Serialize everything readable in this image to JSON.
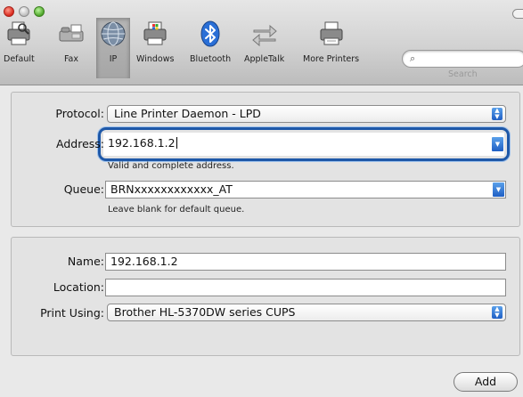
{
  "toolbar": {
    "items": [
      {
        "label": "Default",
        "icon": "default-printer-icon"
      },
      {
        "label": "Fax",
        "icon": "fax-icon"
      },
      {
        "label": "IP",
        "icon": "ip-globe-icon",
        "selected": true
      },
      {
        "label": "Windows",
        "icon": "windows-printer-icon"
      },
      {
        "label": "Bluetooth",
        "icon": "bluetooth-icon"
      },
      {
        "label": "AppleTalk",
        "icon": "appletalk-arrows-icon"
      },
      {
        "label": "More Printers",
        "icon": "more-printers-icon"
      }
    ],
    "search_label": "Search",
    "search_placeholder": ""
  },
  "connection": {
    "protocol_label": "Protocol:",
    "protocol_value": "Line Printer Daemon - LPD",
    "address_label": "Address:",
    "address_value": "192.168.1.2",
    "address_hint": "Valid and complete address.",
    "queue_label": "Queue:",
    "queue_value": "BRNxxxxxxxxxxxx_AT",
    "queue_hint": "Leave blank for default queue."
  },
  "printer": {
    "name_label": "Name:",
    "name_value": "192.168.1.2",
    "location_label": "Location:",
    "location_value": "",
    "print_using_label": "Print Using:",
    "print_using_value": "Brother HL-5370DW series CUPS"
  },
  "actions": {
    "add_label": "Add"
  },
  "colors": {
    "focus_ring": "#1e58a8",
    "popup_arrow": "#1f5fc4"
  }
}
